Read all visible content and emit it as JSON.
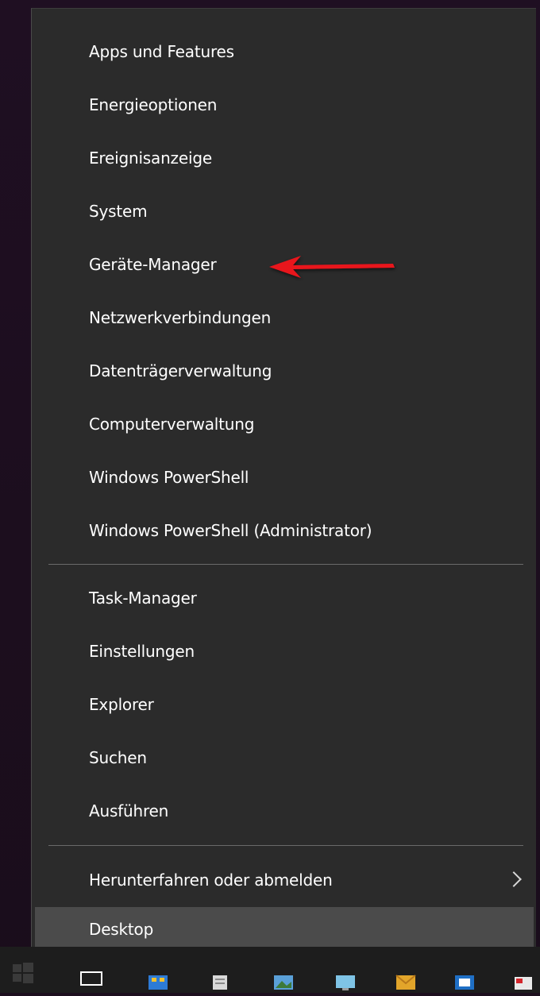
{
  "context_menu": {
    "group1": [
      {
        "label": "Apps und Features"
      },
      {
        "label": "Energieoptionen"
      },
      {
        "label": "Ereignisanzeige"
      },
      {
        "label": "System"
      },
      {
        "label": "Geräte-Manager"
      },
      {
        "label": "Netzwerkverbindungen"
      },
      {
        "label": "Datenträgerverwaltung"
      },
      {
        "label": "Computerverwaltung"
      },
      {
        "label": "Windows PowerShell"
      },
      {
        "label": "Windows PowerShell (Administrator)"
      }
    ],
    "group2": [
      {
        "label": "Task-Manager"
      },
      {
        "label": "Einstellungen"
      },
      {
        "label": "Explorer"
      },
      {
        "label": "Suchen"
      },
      {
        "label": "Ausführen"
      }
    ],
    "group3": [
      {
        "label": "Herunterfahren oder abmelden",
        "has_submenu": true
      },
      {
        "label": "Desktop",
        "selected": true
      }
    ]
  },
  "annotation": {
    "arrow_color": "#e8141c",
    "points_to": "Geräte-Manager"
  },
  "taskbar": {
    "icons": [
      "windows-logo-icon",
      "task-view-icon",
      "store-icon",
      "file-icon",
      "photo-icon",
      "monitor-icon",
      "mail-icon",
      "outlook-icon",
      "app-icon"
    ]
  },
  "colors": {
    "menu_bg": "#2b2b2b",
    "selected_bg": "#4b4b4b",
    "text": "#ffffff"
  }
}
